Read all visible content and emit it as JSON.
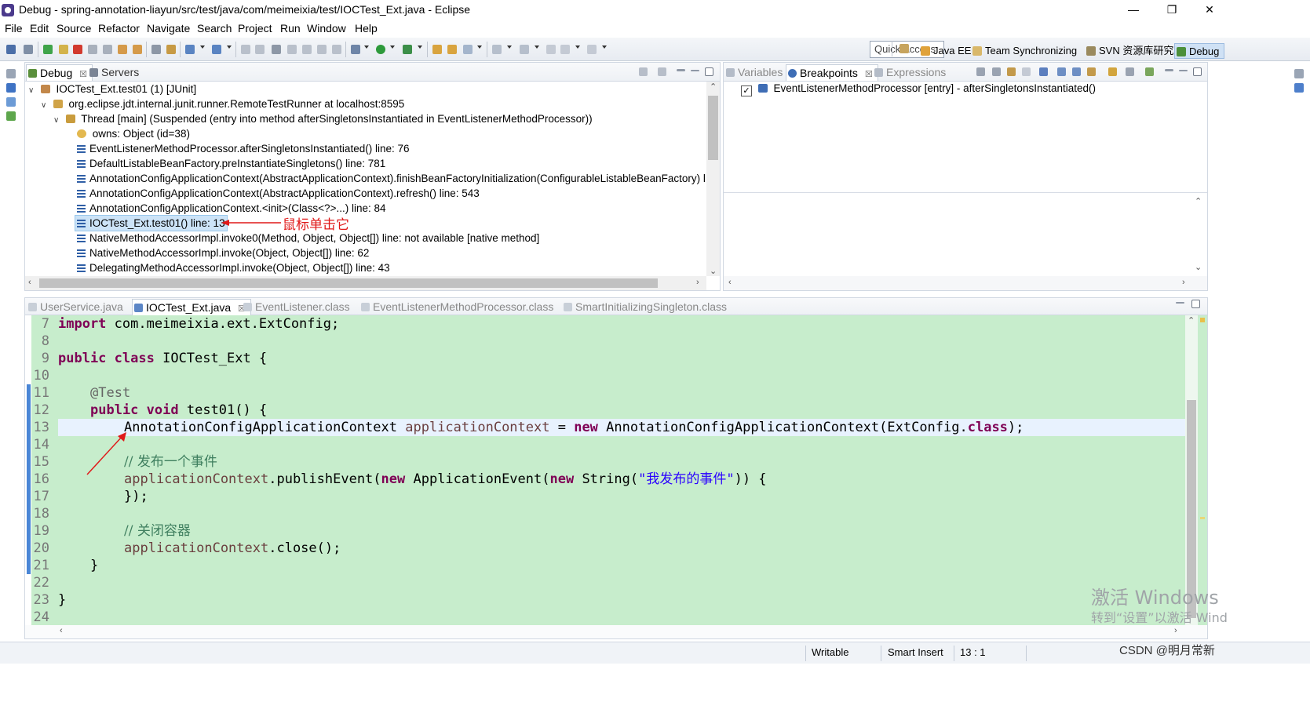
{
  "window": {
    "title": "Debug - spring-annotation-liayun/src/test/java/com/meimeixia/test/IOCTest_Ext.java - Eclipse",
    "minimize": "—",
    "restore": "❐",
    "close": "✕"
  },
  "menu": [
    "File",
    "Edit",
    "Source",
    "Refactor",
    "Navigate",
    "Search",
    "Project",
    "Run",
    "Window",
    "Help"
  ],
  "toolbar": {
    "quick_access": "Quick Access",
    "perspectives": [
      {
        "label": "Java EE",
        "icon": "java-ee-icon"
      },
      {
        "label": "Team Synchronizing",
        "icon": "team-sync-icon"
      },
      {
        "label": "SVN 资源库研究",
        "icon": "svn-icon"
      },
      {
        "label": "Debug",
        "icon": "debug-icon"
      }
    ]
  },
  "debug_view": {
    "tabs": [
      {
        "label": "Debug",
        "close": "☒"
      },
      {
        "label": "Servers"
      }
    ],
    "tree": [
      {
        "text": "IOCTest_Ext.test01 (1) [JUnit]",
        "twisty": "∨"
      },
      {
        "text": "org.eclipse.jdt.internal.junit.runner.RemoteTestRunner at localhost:8595",
        "twisty": "∨"
      },
      {
        "text": "Thread [main] (Suspended (entry into method afterSingletonsInstantiated in EventListenerMethodProcessor))",
        "twisty": "∨"
      },
      {
        "text": "owns: Object  (id=38)"
      },
      {
        "text": "EventListenerMethodProcessor.afterSingletonsInstantiated() line: 76"
      },
      {
        "text": "DefaultListableBeanFactory.preInstantiateSingletons() line: 781"
      },
      {
        "text": "AnnotationConfigApplicationContext(AbstractApplicationContext).finishBeanFactoryInitialization(ConfigurableListableBeanFactory) l"
      },
      {
        "text": "AnnotationConfigApplicationContext(AbstractApplicationContext).refresh() line: 543"
      },
      {
        "text": "AnnotationConfigApplicationContext.<init>(Class<?>...) line: 84"
      },
      {
        "text": "IOCTest_Ext.test01() line: 13"
      },
      {
        "text": "NativeMethodAccessorImpl.invoke0(Method, Object, Object[]) line: not available [native method]"
      },
      {
        "text": "NativeMethodAccessorImpl.invoke(Object, Object[]) line: 62"
      },
      {
        "text": "DelegatingMethodAccessorImpl.invoke(Object, Object[]) line: 43"
      }
    ],
    "annotation": "鼠标单击它"
  },
  "breakpoints_view": {
    "tabs": [
      {
        "label": "Variables"
      },
      {
        "label": "Breakpoints",
        "close": "☒"
      },
      {
        "label": "Expressions"
      }
    ],
    "items": [
      {
        "text": "EventListenerMethodProcessor [entry] - afterSingletonsInstantiated()",
        "checked": true,
        "check_mark": "✓"
      }
    ]
  },
  "editor": {
    "tabs": [
      {
        "label": "UserService.java"
      },
      {
        "label": "IOCTest_Ext.java",
        "close": "☒"
      },
      {
        "label": "EventListener.class"
      },
      {
        "label": "EventListenerMethodProcessor.class"
      },
      {
        "label": "SmartInitializingSingleton.class"
      }
    ],
    "line_numbers": [
      "7",
      "8",
      "9",
      "10",
      "11",
      "12",
      "13",
      "14",
      "15",
      "16",
      "17",
      "18",
      "19",
      "20",
      "21",
      "22",
      "23",
      "24"
    ],
    "code": {
      "l7_kw": "import",
      "l7_rest": " com.meimeixia.ext.ExtConfig;",
      "l9_kw1": "public",
      "l9_kw2": "class",
      "l9_rest": " IOCTest_Ext {",
      "l11_ann": "@Test",
      "l12_kw1": "public",
      "l12_kw2": "void",
      "l12_rest": " test01() {",
      "l13_type": "AnnotationConfigApplicationContext",
      "l13_var": "applicationContext",
      "l13_eq": " = ",
      "l13_kw": "new",
      "l13_ctor": " AnnotationConfigApplicationContext(ExtConfig.",
      "l13_kw2": "class",
      "l13_end": ");",
      "l15_cm": "// 发布一个事件",
      "l16_var": "applicationContext",
      "l16_a": ".publishEvent(",
      "l16_kw1": "new",
      "l16_b": " ApplicationEvent(",
      "l16_kw2": "new",
      "l16_c": " String(",
      "l16_str": "\"我发布的事件\"",
      "l16_d": ")) {",
      "l17": "});",
      "l19_cm": "// 关闭容器",
      "l20_var": "applicationContext",
      "l20_rest": ".close();",
      "l21": "}",
      "l23": "}"
    }
  },
  "status": {
    "writable": "Writable",
    "insert_mode": "Smart Insert",
    "position": "13 : 1"
  },
  "watermark": {
    "line1": "激活 Windows",
    "line2": "转到“设置”以激活 Wind"
  },
  "credit": "CSDN @明月常新"
}
